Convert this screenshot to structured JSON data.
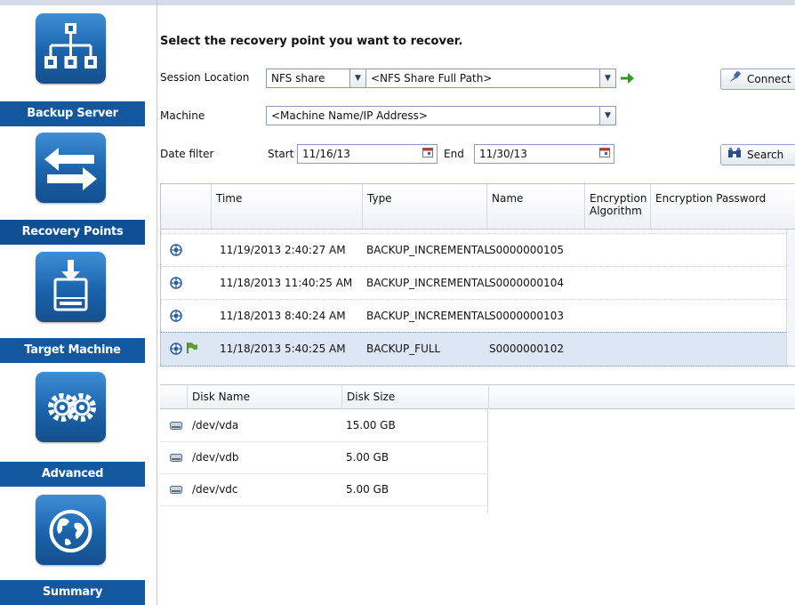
{
  "sidebar": {
    "steps": [
      {
        "label": "Backup Server",
        "icon": "network-tree-icon"
      },
      {
        "label": "Recovery Points",
        "icon": "swap-arrows-icon",
        "active": true
      },
      {
        "label": "Target Machine",
        "icon": "download-drive-icon"
      },
      {
        "label": "Advanced",
        "icon": "gears-icon"
      },
      {
        "label": "Summary",
        "icon": "globe-icon"
      }
    ]
  },
  "main": {
    "heading": "Select the recovery point you want to recover.",
    "session_location_label": "Session Location",
    "session_type": "NFS share",
    "session_path": "<NFS Share Full Path>",
    "connect_label": "Connect",
    "machine_label": "Machine",
    "machine_value": "<Machine Name/IP Address>",
    "date_filter_label": "Date filter",
    "start_label": "Start",
    "start_date": "11/16/13",
    "end_label": "End",
    "end_date": "11/30/13",
    "search_label": "Search"
  },
  "points_table": {
    "columns": [
      "Time",
      "Type",
      "Name",
      "Encryption Algorithm",
      "Encryption Password"
    ],
    "rows": [
      {
        "time": "11/19/2013 2:40:27 AM",
        "type": "BACKUP_INCREMENTAL",
        "name": "S0000000105",
        "full": false,
        "selected": false
      },
      {
        "time": "11/18/2013 11:40:25 AM",
        "type": "BACKUP_INCREMENTAL",
        "name": "S0000000104",
        "full": false,
        "selected": false
      },
      {
        "time": "11/18/2013 8:40:24 AM",
        "type": "BACKUP_INCREMENTAL",
        "name": "S0000000103",
        "full": false,
        "selected": false
      },
      {
        "time": "11/18/2013 5:40:25 AM",
        "type": "BACKUP_FULL",
        "name": "S0000000102",
        "full": true,
        "selected": true
      }
    ]
  },
  "disk_table": {
    "columns": [
      "Disk Name",
      "Disk Size"
    ],
    "rows": [
      {
        "name": "/dev/vda",
        "size": "15.00 GB"
      },
      {
        "name": "/dev/vdb",
        "size": "5.00 GB"
      },
      {
        "name": "/dev/vdc",
        "size": "5.00 GB"
      }
    ]
  },
  "colors": {
    "sidebar_label": "#13589f",
    "tile": "#1a63ab",
    "selected_row": "#dce6f4"
  }
}
